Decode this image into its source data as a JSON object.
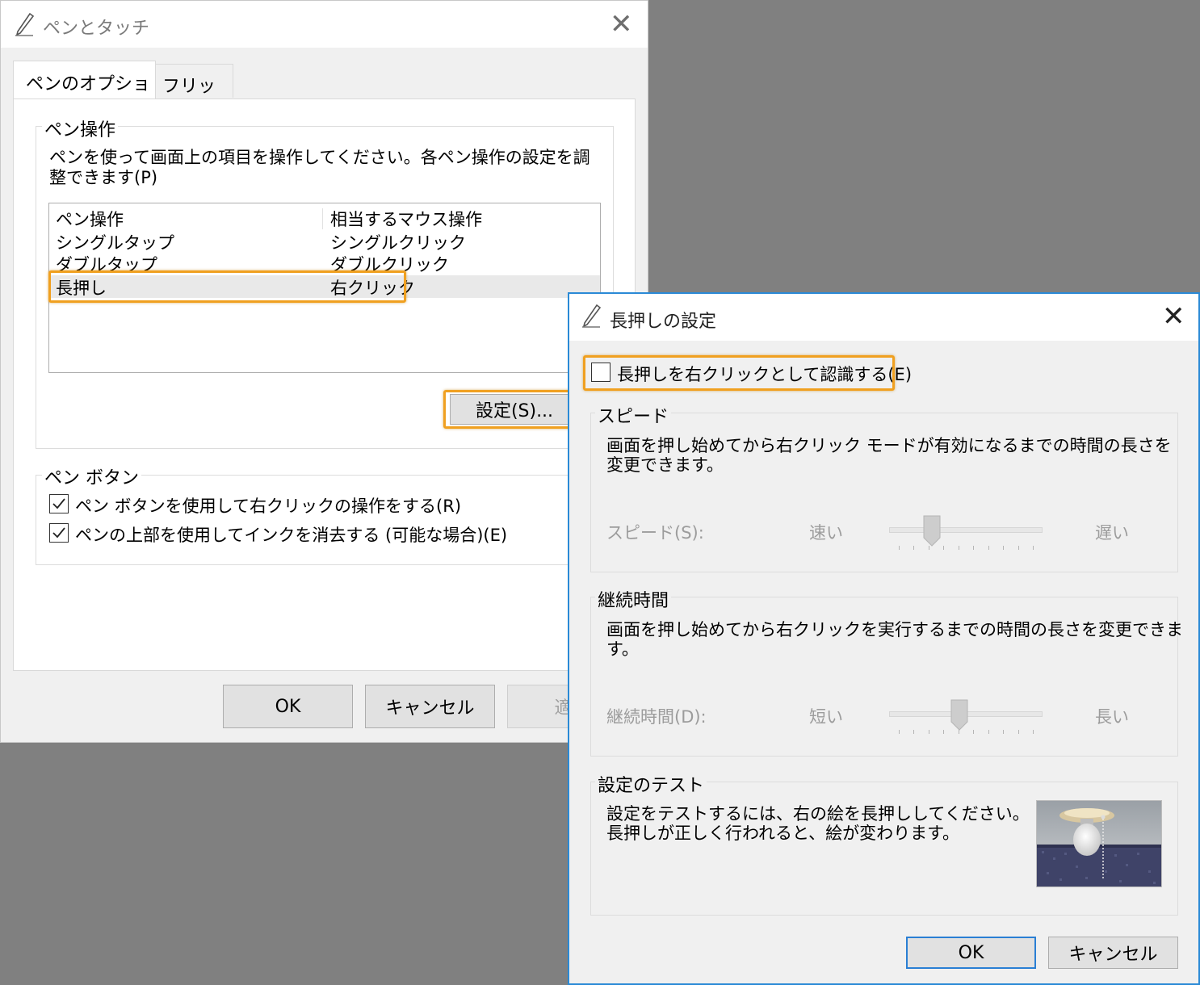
{
  "main_window": {
    "title": "ペンとタッチ",
    "icon": "pen-icon",
    "close_glyph": "✕",
    "tabs": [
      {
        "label": "ペンのオプション",
        "active": true
      },
      {
        "label": "フリック",
        "active": false
      }
    ],
    "pen_actions": {
      "group_label": "ペン操作",
      "description_line1": "ペンを使って画面上の項目を操作してください。各ペン操作の設定を調",
      "description_line2": "整できます(P)",
      "columns": [
        "ペン操作",
        "相当するマウス操作"
      ],
      "rows": [
        {
          "action": "シングルタップ",
          "mouse": "シングルクリック",
          "selected": false
        },
        {
          "action": "ダブルタップ",
          "mouse": "ダブルクリック",
          "selected": false
        },
        {
          "action": "長押し",
          "mouse": "右クリック",
          "selected": true
        }
      ],
      "settings_button": "設定(S)..."
    },
    "pen_buttons": {
      "group_label": "ペン ボタン",
      "options": [
        {
          "label": "ペン ボタンを使用して右クリックの操作をする(R)",
          "checked": true
        },
        {
          "label": "ペンの上部を使用してインクを消去する (可能な場合)(E)",
          "checked": true
        }
      ]
    },
    "buttons": {
      "ok": "OK",
      "cancel": "キャンセル",
      "apply": "適用"
    }
  },
  "press_hold_dialog": {
    "title": "長押しの設定",
    "icon": "pen-icon",
    "close_glyph": "✕",
    "enable_checkbox": {
      "label": "長押しを右クリックとして認識する(E)",
      "checked": false
    },
    "speed": {
      "group_label": "スピード",
      "description_line1": "画面を押し始めてから右クリック モードが有効になるまでの時間の長さを",
      "description_line2": "変更できます。",
      "slider_label": "スピード(S):",
      "min_label": "速い",
      "max_label": "遅い",
      "value_fraction": 0.25,
      "tick_count": 10,
      "enabled": false
    },
    "duration": {
      "group_label": "継続時間",
      "description_line1": "画面を押し始めてから右クリックを実行するまでの時間の長さを変更できま",
      "description_line2": "す。",
      "slider_label": "継続時間(D):",
      "min_label": "短い",
      "max_label": "長い",
      "value_fraction": 0.45,
      "tick_count": 10,
      "enabled": false
    },
    "test": {
      "group_label": "設定のテスト",
      "description_line1": "設定をテストするには、右の絵を長押ししてください。",
      "description_line2": "長押しが正しく行われると、絵が変わります。",
      "image": "lightbulb-test-image"
    },
    "buttons": {
      "ok": "OK",
      "cancel": "キャンセル"
    }
  },
  "colors": {
    "highlight": "#f0a020",
    "dialog_border": "#2a8ad6",
    "desktop": "#808080"
  }
}
